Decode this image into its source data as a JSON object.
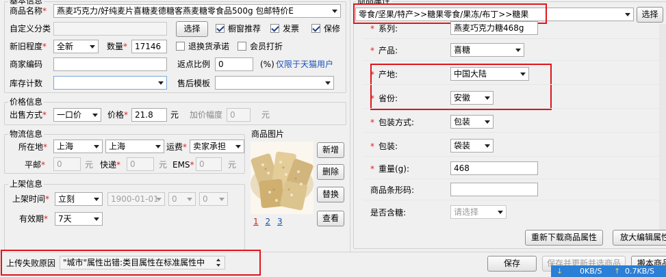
{
  "basic": {
    "group_title": "基本信息",
    "product_name_label": "商品名称",
    "product_name_value": "燕麦巧克力/好纯麦片喜糖麦德糖客燕麦糖零食品500g 包邮特价E",
    "custom_category_label": "自定义分类",
    "select_button": "选择",
    "window_recommend": "橱窗推荐",
    "invoice": "发票",
    "warranty": "保修",
    "condition_label": "新旧程度",
    "condition_value": "全新",
    "quantity_label": "数量",
    "quantity_value": "17146",
    "return_promise": "退换货承诺",
    "member_discount": "会员打折",
    "merchant_code_label": "商家编码",
    "rebate_label": "返点比例",
    "rebate_value": "0",
    "rebate_unit": "(%)",
    "rebate_note": "仅限于天猫用户",
    "stock_count_label": "库存计数",
    "after_sale_label": "售后模板"
  },
  "price": {
    "group_title": "价格信息",
    "sale_method_label": "出售方式",
    "sale_method_value": "一口价",
    "price_label": "价格",
    "price_value": "21.8",
    "yuan": "元",
    "markup_label": "加价幅度",
    "markup_value": "0",
    "yuan2": "元"
  },
  "logistics": {
    "group_title": "物流信息",
    "location_label": "所在地",
    "province": "上海",
    "city": "上海",
    "freight_label": "运费",
    "freight_value": "卖家承担",
    "post_label": "平邮",
    "post_value": "0",
    "yuan_a": "元",
    "express_label": "快递",
    "express_value": "0",
    "yuan_b": "元",
    "ems_label": "EMS",
    "ems_value": "0",
    "yuan_c": "元"
  },
  "listing": {
    "group_title": "上架信息",
    "time_label": "上架时间",
    "time_value": "立刻",
    "date_value": "1900-01-01",
    "hour_value": "0",
    "minute_value": "0",
    "validity_label": "有效期",
    "validity_value": "7天"
  },
  "images": {
    "title": "商品图片",
    "add": "新增",
    "delete": "删除",
    "replace": "替换",
    "view": "查看",
    "pages": [
      "1",
      "2",
      "3"
    ]
  },
  "attributes": {
    "group_title": "商品属性",
    "category_path": "零食/坚果/特产>>糖果零食/果冻/布丁>>糖果",
    "select_button": "选择",
    "rows": [
      {
        "label": "系列:",
        "value": "燕麦巧克力糖468g",
        "required": true,
        "kind": "input"
      },
      {
        "label": "产品:",
        "value": "喜糖",
        "required": true,
        "kind": "select"
      },
      {
        "label": "产地:",
        "value": "中国大陆",
        "required": true,
        "kind": "select"
      },
      {
        "label": "省份:",
        "value": "安徽",
        "required": true,
        "kind": "select"
      },
      {
        "label": "包装方式:",
        "value": "包装",
        "required": true,
        "kind": "select"
      },
      {
        "label": "包装:",
        "value": "袋装",
        "required": true,
        "kind": "select"
      },
      {
        "label": "重量(g):",
        "value": "468",
        "required": true,
        "kind": "input"
      },
      {
        "label": "商品条形码:",
        "value": "",
        "required": false,
        "kind": "input"
      },
      {
        "label": "是否含糖:",
        "value": "请选择",
        "required": false,
        "kind": "select-placeholder"
      }
    ],
    "redownload_button": "重新下载商品属性",
    "enlarge_button": "放大编辑属性"
  },
  "footer": {
    "fail_reason_label": "上传失败原因",
    "fail_reason_text": "\"城市\"属性出错:类目属性在标准属性中",
    "save_button": "保存",
    "save_next_button": "保存并更新并选商品",
    "last_button": "搬本商品"
  },
  "network": {
    "down_speed": "0KB/S",
    "up_speed": "0.7KB/S"
  },
  "colors": {
    "highlight": "#e0141b",
    "link": "#1a4fb5",
    "required": "#e02020",
    "net_bar": "#2a7fd6"
  }
}
